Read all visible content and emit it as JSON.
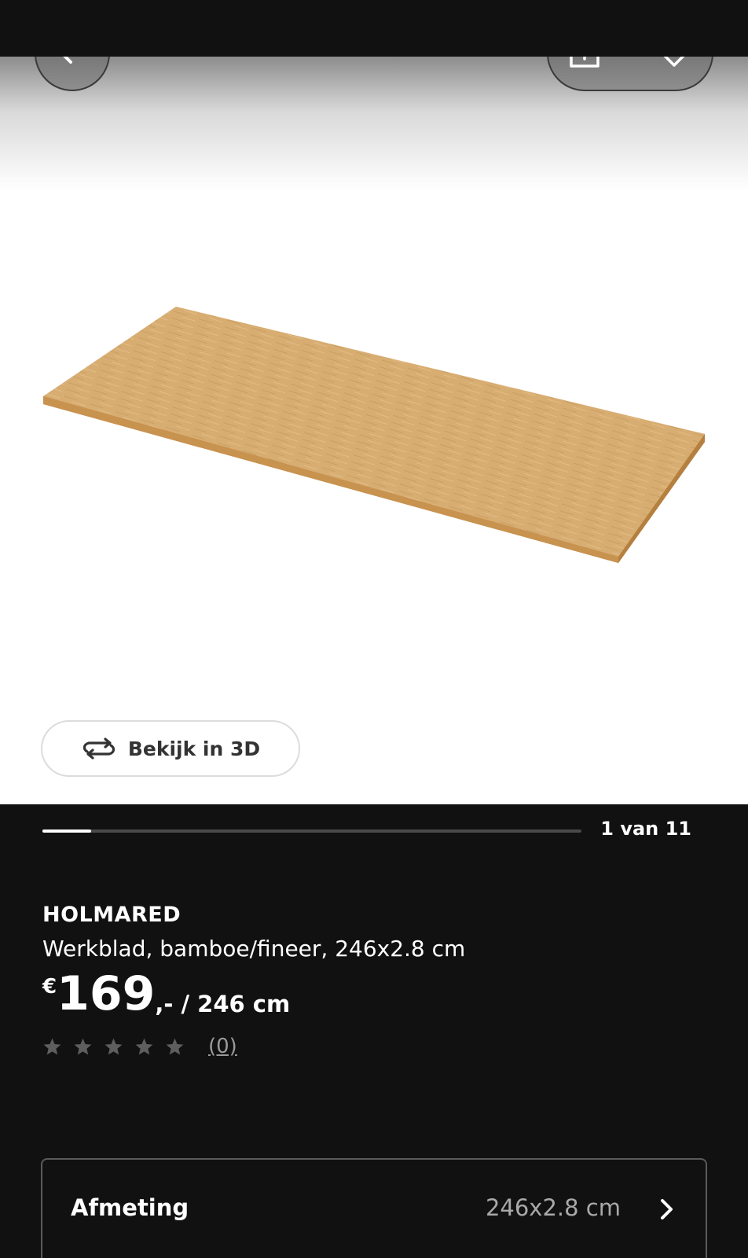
{
  "nav": {
    "back_icon": "arrow-left-icon",
    "share_icon": "share-icon",
    "favorite_icon": "heart-icon"
  },
  "gallery": {
    "image": "bamboo worktop board",
    "view3d_label": "Bekijk in 3D",
    "view3d_icon": "rotate-3d-icon",
    "counter": "1 van 11",
    "current": 1,
    "total": 11
  },
  "product": {
    "name": "HOLMARED",
    "description": "Werkblad, bamboe/fineer, 246x2.8 cm",
    "price_currency": "€",
    "price_amount": "169",
    "price_suffix": ",- / 246 cm",
    "rating_stars": 0,
    "rating_max": 5,
    "review_count": "(0)"
  },
  "dimension": {
    "label": "Afmeting",
    "value": "246x2.8 cm",
    "chevron_icon": "chevron-right-icon"
  },
  "colors": {
    "background": "#111111",
    "board_top": "#d7ab6e",
    "board_edge": "#c2894a"
  }
}
